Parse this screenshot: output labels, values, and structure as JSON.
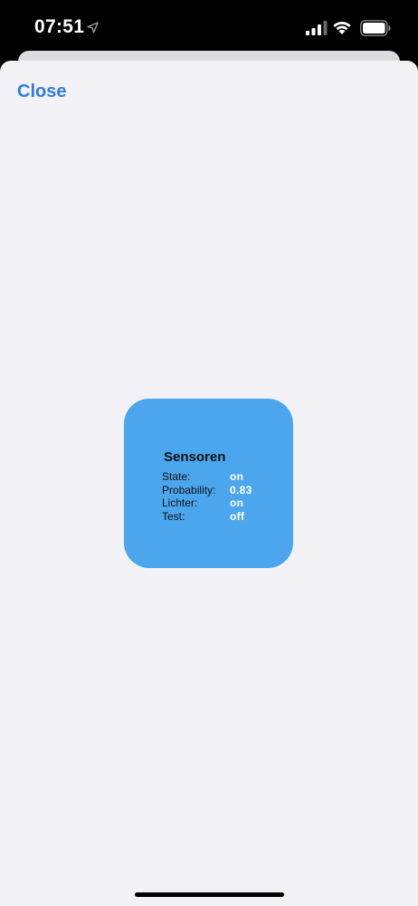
{
  "status_bar": {
    "time": "07:51"
  },
  "header": {
    "close_label": "Close"
  },
  "widget": {
    "title": "Sensoren",
    "rows": [
      {
        "label": "State:",
        "value": "on"
      },
      {
        "label": "Probability:",
        "value": "0.83"
      },
      {
        "label": "Lichter:",
        "value": "on"
      },
      {
        "label": "Test:",
        "value": "off"
      }
    ],
    "background_color": "#4ba6ee"
  },
  "colors": {
    "accent": "#2f7de0",
    "sheet_background": "#f2f2f6"
  },
  "icons": {
    "location": "location-arrow-icon",
    "signal": "cellular-signal-icon",
    "wifi": "wifi-icon",
    "battery": "battery-icon"
  }
}
